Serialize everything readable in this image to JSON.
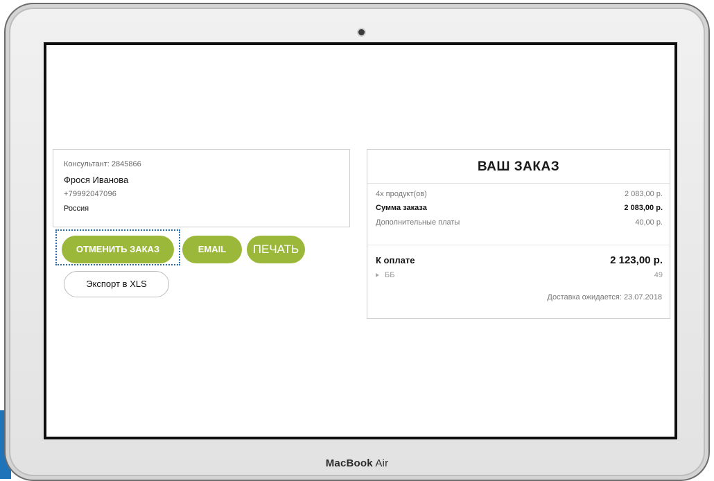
{
  "device": {
    "brand_bold": "MacBook",
    "brand_light": "Air"
  },
  "customer": {
    "consultant": "Консультант: 2845866",
    "name": "Фрося Иванова",
    "phone": "+79992047096",
    "country": "Россия"
  },
  "actions": {
    "cancel_label": "ОТМЕНИТЬ ЗАКАЗ",
    "email_label": "EMAIL",
    "print_label": "ПЕЧАТЬ",
    "export_label": "Экспорт в XLS"
  },
  "order": {
    "title": "ВАШ ЗАКАЗ",
    "rows": [
      {
        "label": "4x продукт(ов)",
        "value": "2 083,00 р."
      },
      {
        "label": "Сумма заказа",
        "value": "2 083,00 р."
      },
      {
        "label": "Дополнительные платы",
        "value": "40,00 р."
      }
    ],
    "total": {
      "label": "К оплате",
      "value": "2 123,00 р."
    },
    "bb": {
      "label": "ББ",
      "value": "49"
    },
    "delivery": "Доставка ожидается: 23.07.2018"
  },
  "colors": {
    "accent": "#9cb83b",
    "focus": "#2a6cb0"
  }
}
